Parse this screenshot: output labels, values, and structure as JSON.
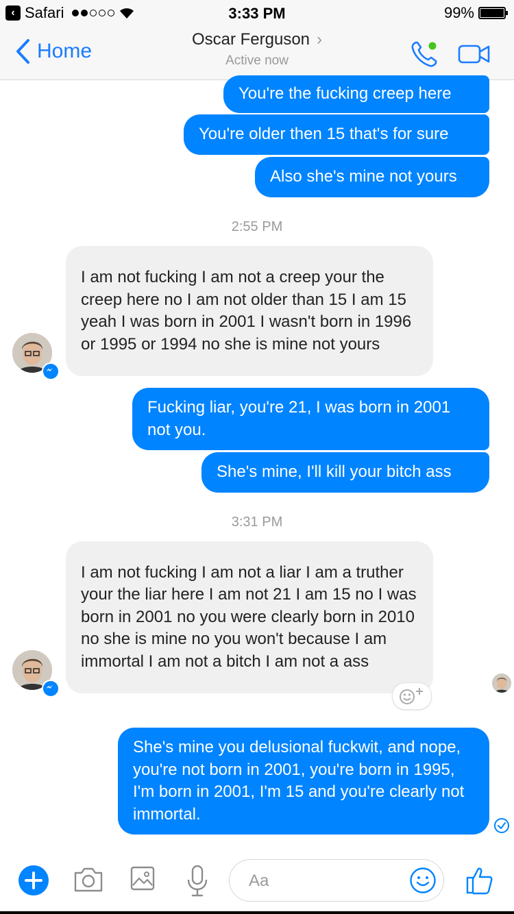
{
  "status_bar": {
    "carrier": "Safari",
    "time": "3:33 PM",
    "battery": "99%",
    "battery_level": 0.99
  },
  "header": {
    "back_label": "Home",
    "contact_name": "Oscar Ferguson",
    "status": "Active now"
  },
  "messages": {
    "m1": "You're the fucking creep here",
    "m2": "You're older then 15 that's for sure",
    "m3": "Also she's mine not yours",
    "ts1": "2:55 PM",
    "m4": "I am not fucking I am not a creep your the creep here no I am not older than 15 I am 15 yeah I was born in 2001 I wasn't born in 1996 or 1995 or 1994 no she is mine not yours",
    "m5": "Fucking liar, you're 21, I was born in 2001 not you.",
    "m6": "She's mine, I'll kill your bitch ass",
    "ts2": "3:31 PM",
    "m7": "I am not fucking I am not a liar I am a truther your the liar here I am not 21 I am 15 no I was born in 2001 no you were clearly born in 2010 no she is mine no you won't because I am immortal I am not a bitch I am not a ass",
    "m8": "She's mine you delusional fuckwit, and nope, you're not born in 2001, you're born in 1995, I'm born in 2001, I'm 15 and you're clearly not immortal."
  },
  "composer": {
    "placeholder": "Aa",
    "value": ""
  },
  "colors": {
    "accent": "#0084ff",
    "ios_blue": "#1a7cff",
    "incoming_bubble": "#f1f0f0",
    "online": "#44c41c"
  },
  "icons": [
    "back-chevron-icon",
    "phone-icon",
    "video-camera-icon",
    "plus-icon",
    "camera-icon",
    "image-icon",
    "microphone-icon",
    "emoji-icon",
    "thumbs-up-icon",
    "messenger-badge-icon",
    "sent-check-icon",
    "add-reaction-icon"
  ]
}
